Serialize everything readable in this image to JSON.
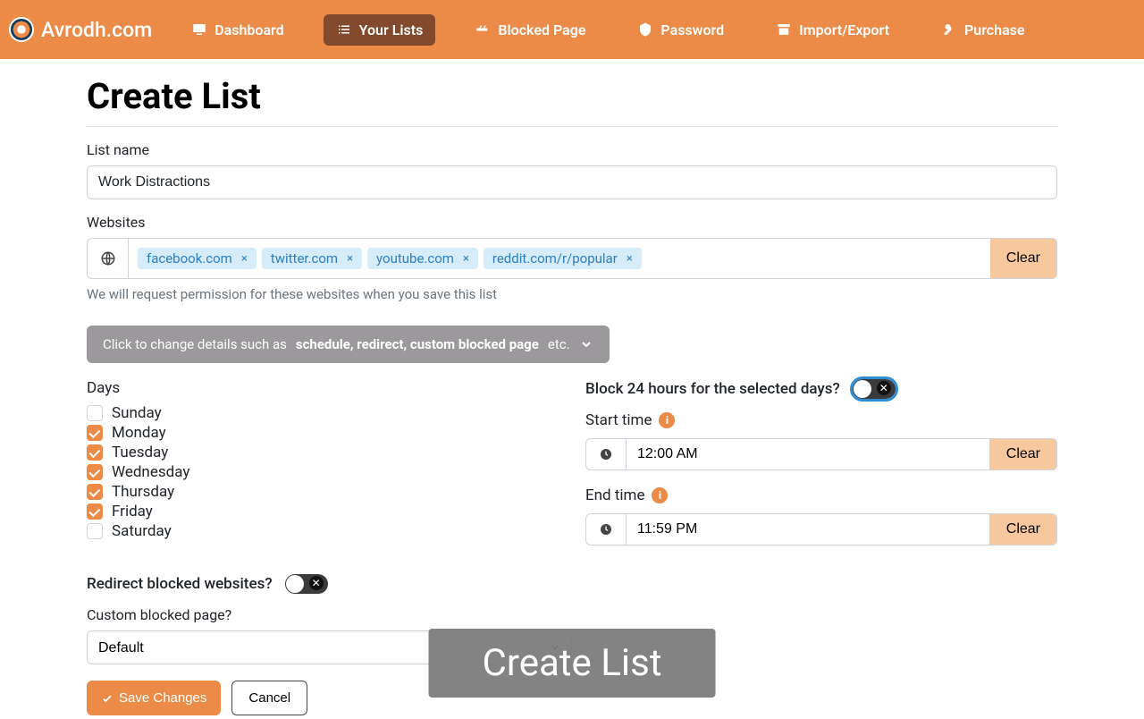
{
  "brand": "Avrodh.com",
  "nav": {
    "dashboard": "Dashboard",
    "yourlists": "Your Lists",
    "blockedpage": "Blocked Page",
    "password": "Password",
    "importexport": "Import/Export",
    "purchase": "Purchase"
  },
  "page": {
    "title": "Create List",
    "listname_label": "List name",
    "listname_value": "Work Distractions",
    "websites_label": "Websites",
    "tags": [
      "facebook.com",
      "twitter.com",
      "youtube.com",
      "reddit.com/r/popular"
    ],
    "tag_remove": "×",
    "clear": "Clear",
    "websites_hint": "We will request permission for these websites when you save this list",
    "expand_pre": "Click to change details such as ",
    "expand_bold": "schedule, redirect, custom blocked page",
    "expand_post": " etc."
  },
  "days": {
    "label": "Days",
    "items": [
      {
        "label": "Sunday",
        "checked": false
      },
      {
        "label": "Monday",
        "checked": true
      },
      {
        "label": "Tuesday",
        "checked": true
      },
      {
        "label": "Wednesday",
        "checked": true
      },
      {
        "label": "Thursday",
        "checked": true
      },
      {
        "label": "Friday",
        "checked": true
      },
      {
        "label": "Saturday",
        "checked": false
      }
    ]
  },
  "right": {
    "block24_label": "Block 24 hours for the selected days?",
    "start_label": "Start time",
    "start_value": "12:00 AM",
    "end_label": "End time",
    "end_value": "11:59 PM",
    "info": "i",
    "clear": "Clear"
  },
  "redirect_label": "Redirect blocked websites?",
  "custom": {
    "label": "Custom blocked page?",
    "value": "Default"
  },
  "actions": {
    "save": "Save Changes",
    "cancel": "Cancel"
  },
  "toast": "Create List"
}
